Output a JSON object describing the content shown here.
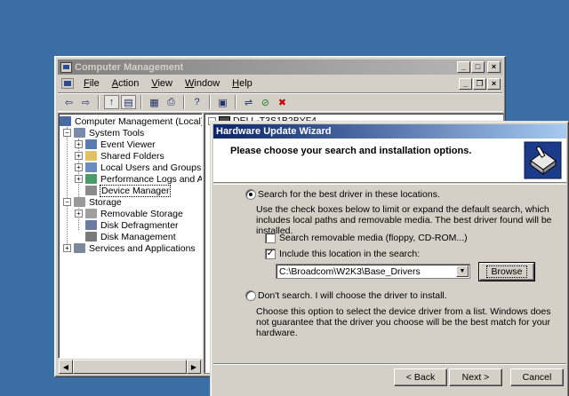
{
  "cm_window": {
    "title": "Computer Management",
    "menu": [
      "File",
      "Action",
      "View",
      "Window",
      "Help"
    ],
    "menu_accel": [
      "F",
      "A",
      "V",
      "W",
      "H"
    ],
    "title_buttons": {
      "minimize": "_",
      "maximize": "□",
      "close": "×"
    },
    "mdi_buttons": {
      "minimize": "_",
      "restore": "❐",
      "close": "×"
    }
  },
  "tree": {
    "items": [
      {
        "label": "Computer Management (Local)"
      },
      {
        "label": "System Tools"
      },
      {
        "label": "Event Viewer"
      },
      {
        "label": "Shared Folders"
      },
      {
        "label": "Local Users and Groups"
      },
      {
        "label": "Performance Logs and Alerts"
      },
      {
        "label": "Device Manager"
      },
      {
        "label": "Storage"
      },
      {
        "label": "Removable Storage"
      },
      {
        "label": "Disk Defragmenter"
      },
      {
        "label": "Disk Management"
      },
      {
        "label": "Services and Applications"
      }
    ],
    "expander_plus": "+",
    "expander_minus": "−"
  },
  "right_pane": {
    "root_label": "DELL-T3S1B2BYF4"
  },
  "wizard": {
    "title": "Hardware Update Wizard",
    "header": "Please choose your search and installation options.",
    "option_search": "Search for the best driver in these locations.",
    "search_desc": "Use the check boxes below to limit or expand the default search, which includes local paths and removable media. The best driver found will be installed.",
    "chk_removable": "Search removable media (floppy, CD-ROM...)",
    "chk_include": "Include this location in the search:",
    "location_value": "C:\\Broadcom\\W2K3\\Base_Drivers",
    "browse_label": "Browse",
    "option_dont": "Don't search. I will choose the driver to install.",
    "dont_desc": "Choose this option to select the device driver from a list.  Windows does not guarantee that the driver you choose will be the best match for your hardware.",
    "back_label": "< Back",
    "next_label": "Next >",
    "cancel_label": "Cancel"
  },
  "colors": {
    "desktop": "#3a6ea5",
    "active_title": "#0a246a",
    "inactive_title": "#808080",
    "face": "#d4d0c8"
  }
}
